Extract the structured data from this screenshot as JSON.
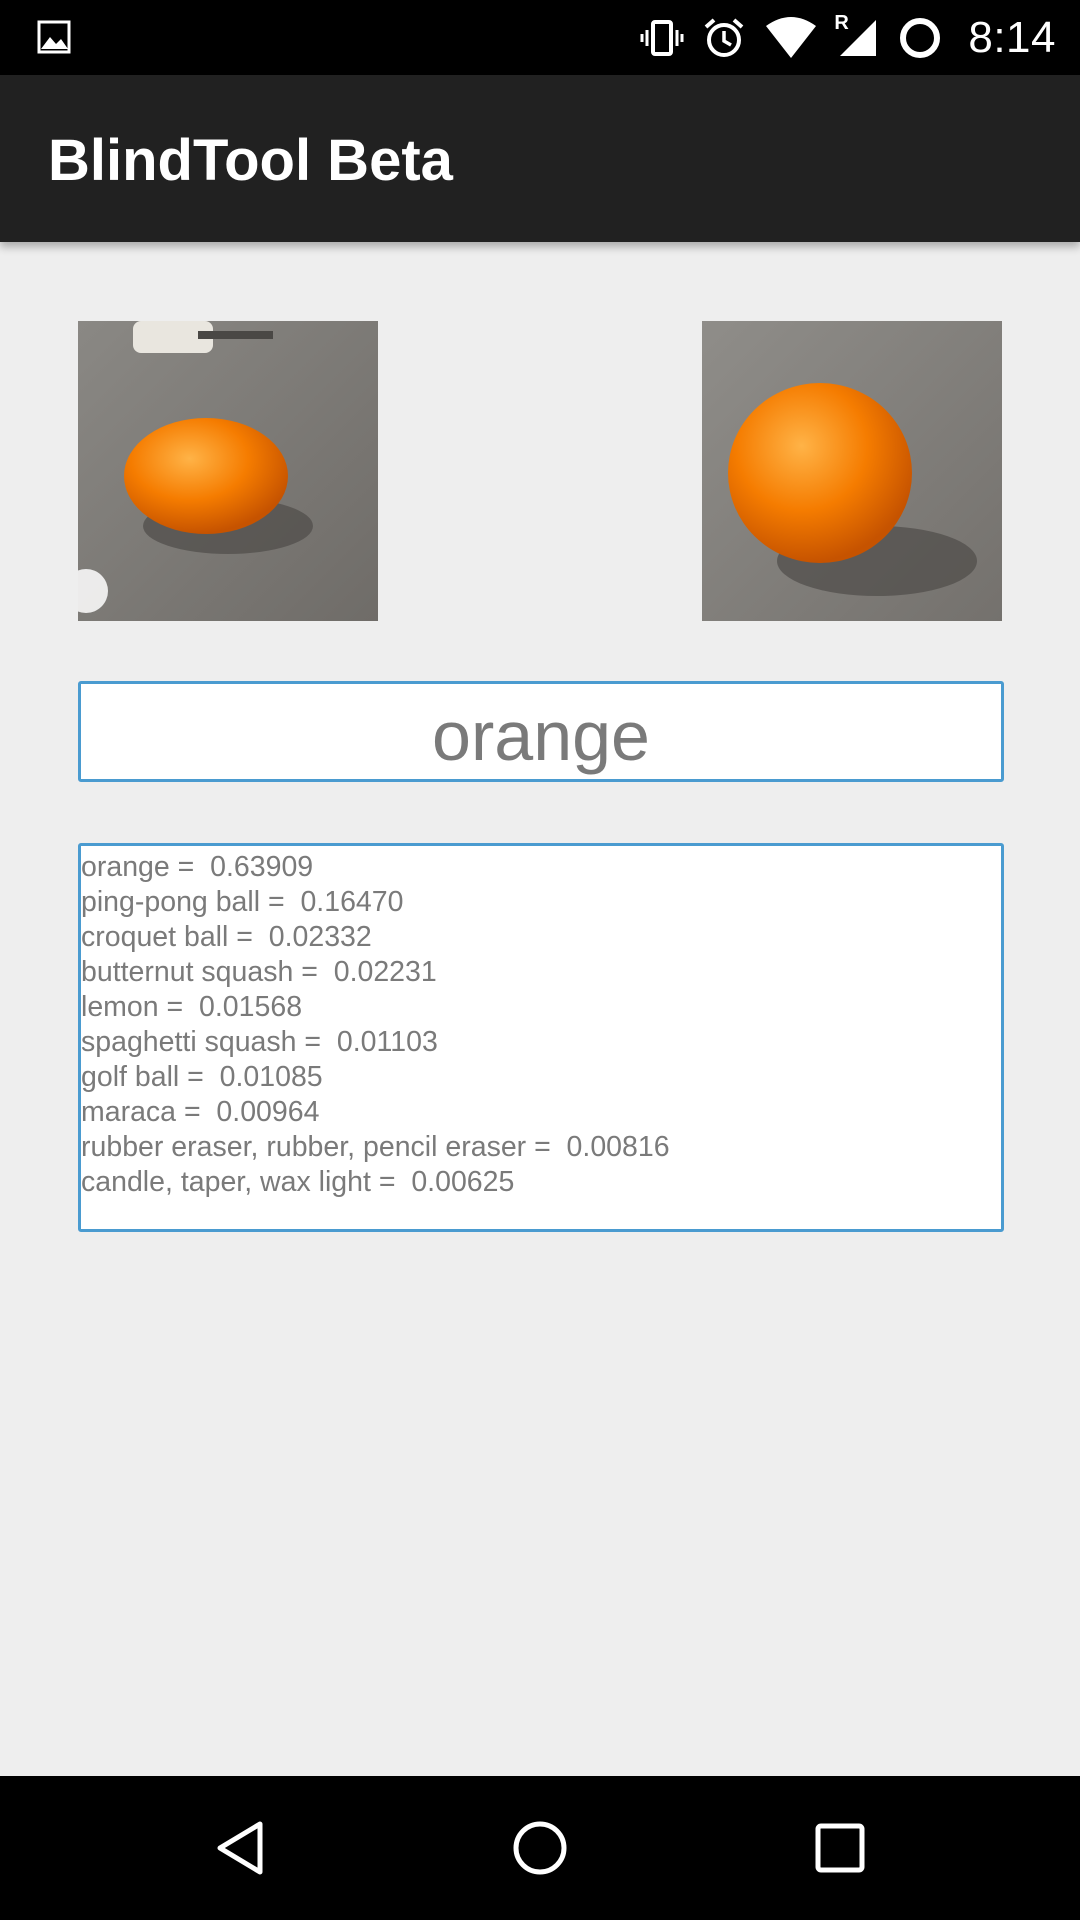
{
  "status_bar": {
    "time": "8:14",
    "icons": [
      "gallery-icon",
      "vibrate-icon",
      "alarm-icon",
      "wifi-icon",
      "signal-roaming-icon",
      "battery-icon"
    ],
    "roaming_indicator": "R"
  },
  "app_bar": {
    "title": "BlindTool Beta"
  },
  "images": {
    "left": "camera-frame-orange",
    "right": "crop-orange"
  },
  "prediction": {
    "label": "orange"
  },
  "results": [
    "orange =  0.63909",
    "ping-pong ball =  0.16470",
    "croquet ball =  0.02332",
    "butternut squash =  0.02231",
    "lemon =  0.01568",
    "spaghetti squash =  0.01103",
    "golf ball =  0.01085",
    "maraca =  0.00964",
    "rubber eraser, rubber, pencil eraser =  0.00816",
    "candle, taper, wax light =  0.00625"
  ],
  "nav_bar": {
    "icons": [
      "back-icon",
      "home-icon",
      "recents-icon"
    ]
  },
  "colors": {
    "app_bar": "#212121",
    "background": "#eeeeee",
    "box_border": "#4a9bd0",
    "text": "#7a7a7a"
  }
}
